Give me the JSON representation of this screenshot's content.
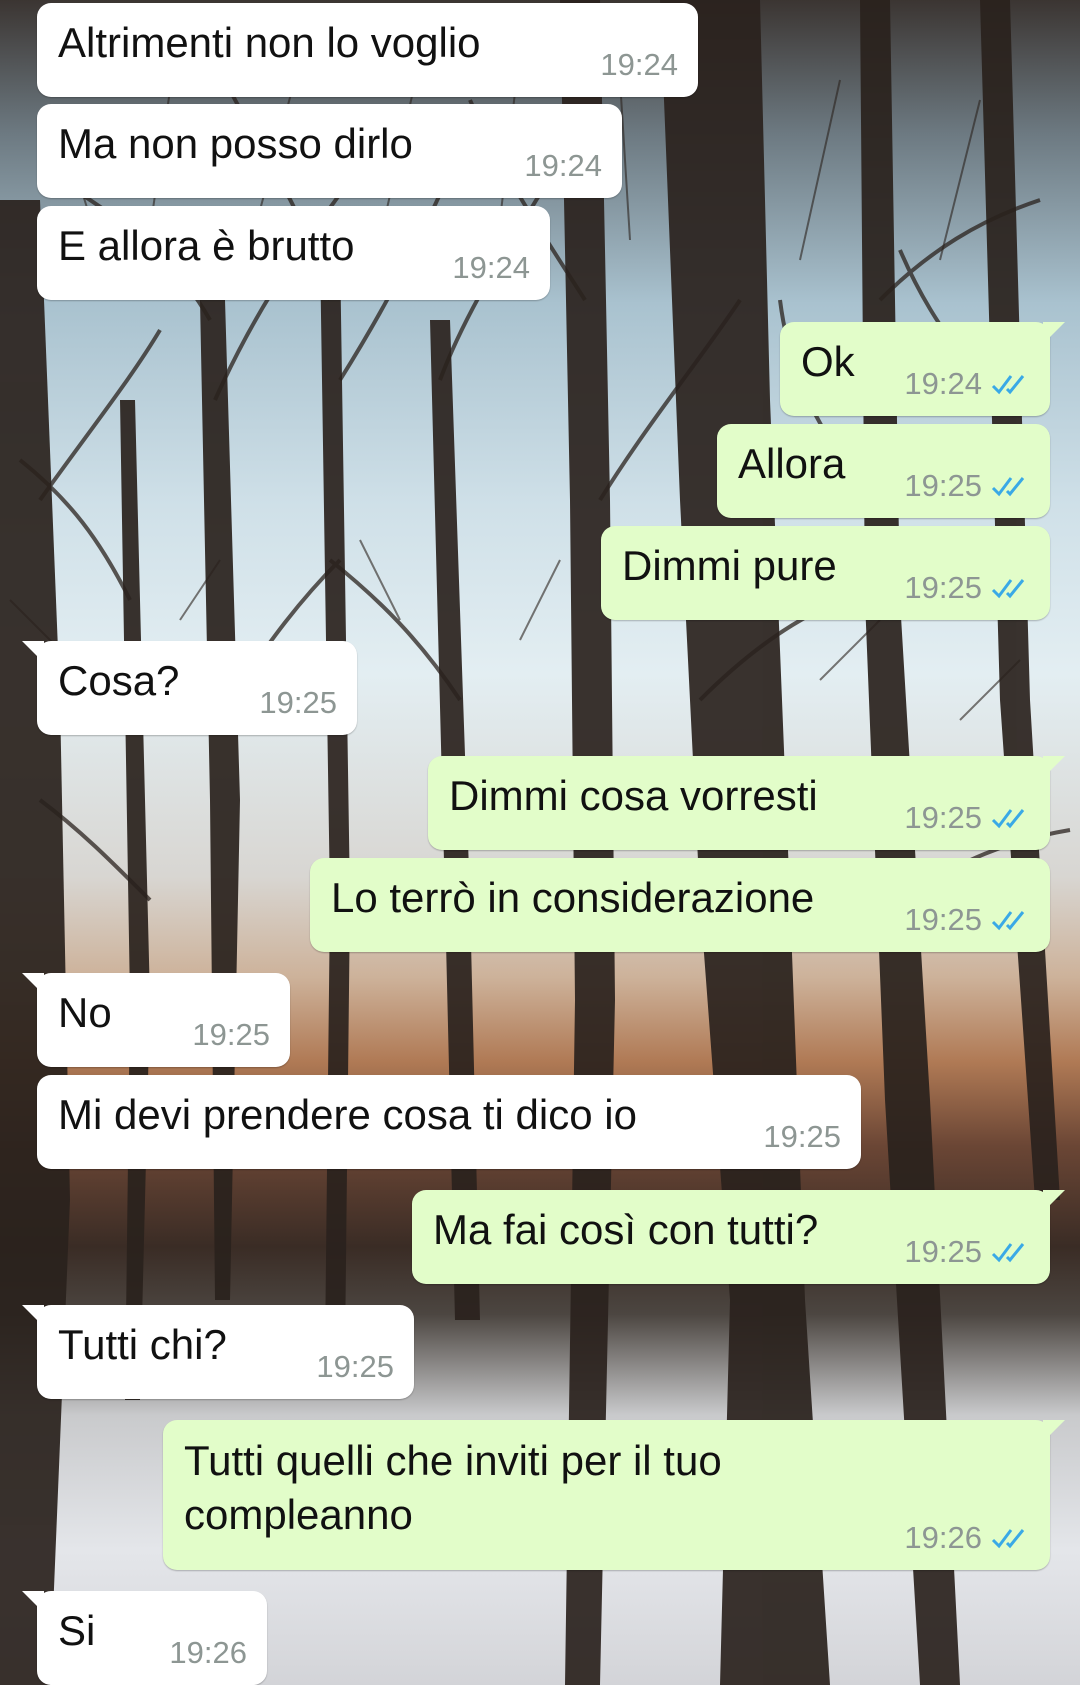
{
  "colors": {
    "incoming_bubble": "#ffffff",
    "outgoing_bubble": "#e2fdc9",
    "timestamp": "#8d9693",
    "read_ticks": "#3aa9e6"
  },
  "messages": [
    {
      "dir": "in",
      "text": "Altrimenti non lo voglio",
      "time": "19:24"
    },
    {
      "dir": "in",
      "text": "Ma non posso dirlo",
      "time": "19:24"
    },
    {
      "dir": "in",
      "text": "E allora è brutto",
      "time": "19:24"
    },
    {
      "dir": "out",
      "text": "Ok",
      "time": "19:24",
      "status": "read"
    },
    {
      "dir": "out",
      "text": "Allora",
      "time": "19:25",
      "status": "read"
    },
    {
      "dir": "out",
      "text": "Dimmi pure",
      "time": "19:25",
      "status": "read"
    },
    {
      "dir": "in",
      "text": "Cosa?",
      "time": "19:25"
    },
    {
      "dir": "out",
      "text": "Dimmi cosa vorresti",
      "time": "19:25",
      "status": "read"
    },
    {
      "dir": "out",
      "text": "Lo terrò in considerazione",
      "time": "19:25",
      "status": "read"
    },
    {
      "dir": "in",
      "text": "No",
      "time": "19:25"
    },
    {
      "dir": "in",
      "text": "Mi devi prendere cosa ti dico io",
      "time": "19:25"
    },
    {
      "dir": "out",
      "text": "Ma fai così con tutti?",
      "time": "19:25",
      "status": "read"
    },
    {
      "dir": "in",
      "text": "Tutti chi?",
      "time": "19:25"
    },
    {
      "dir": "out",
      "text": "Tutti quelli che inviti per il tuo compleanno",
      "time": "19:26",
      "status": "read"
    },
    {
      "dir": "in",
      "text": "Si",
      "time": "19:26"
    }
  ]
}
